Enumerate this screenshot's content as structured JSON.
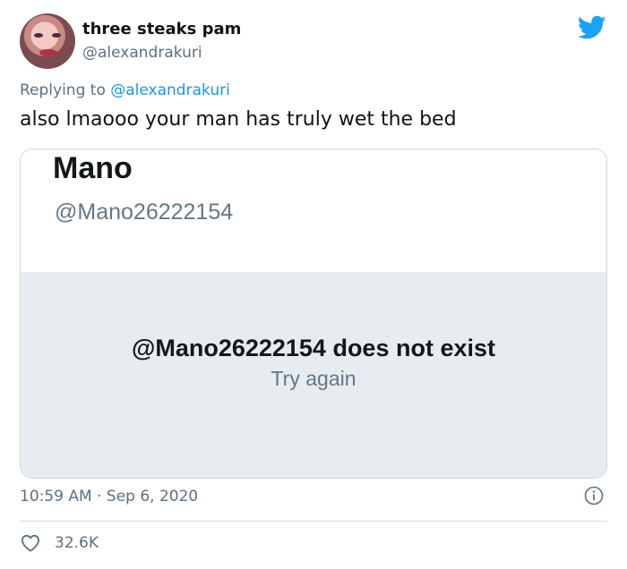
{
  "tweet": {
    "author_name": "three steaks pam",
    "author_handle": "@alexandrakuri",
    "replying_prefix": "Replying to",
    "replying_handle": "@alexandrakuri",
    "text": "also lmaooo your man has truly wet the bed",
    "timestamp": "10:59 AM · Sep 6, 2020",
    "likes": "32.6K"
  },
  "embedded_card": {
    "name": "Mano",
    "handle": "@Mano26222154",
    "error_message": "@Mano26222154 does not exist",
    "retry_label": "Try again"
  },
  "icons": {
    "brand": "twitter-bird-icon",
    "info": "info-icon",
    "like": "heart-icon"
  },
  "colors": {
    "brand_blue": "#1da1f2",
    "link_blue": "#1b95e0",
    "secondary_text": "#5b7083",
    "card_gray": "#e6ecf0"
  }
}
